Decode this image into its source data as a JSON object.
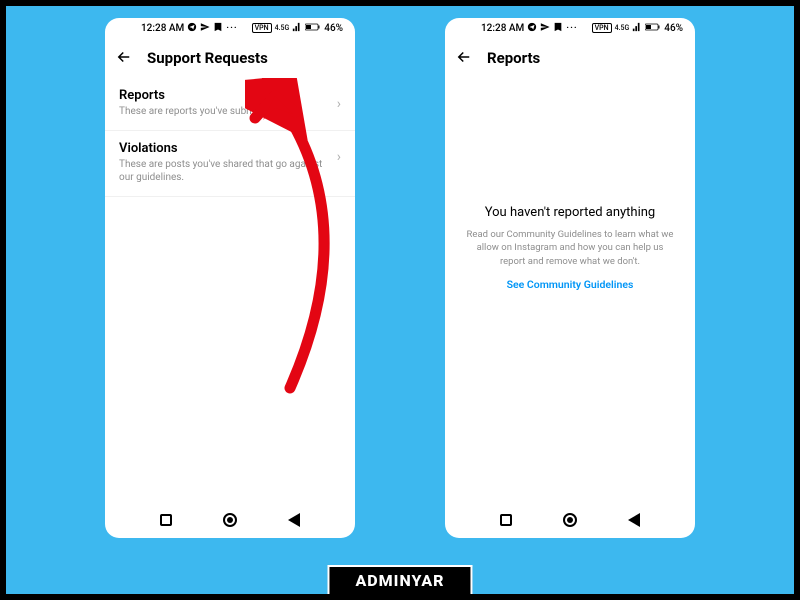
{
  "statusBar": {
    "time": "12:28 AM",
    "vpnLabel": "VPN",
    "networkLabel": "4.5G",
    "batteryText": "46%"
  },
  "phoneLeft": {
    "headerTitle": "Support Requests",
    "items": [
      {
        "title": "Reports",
        "desc": "These are reports you've submitted."
      },
      {
        "title": "Violations",
        "desc": "These are posts you've shared that go against our guidelines."
      }
    ]
  },
  "phoneRight": {
    "headerTitle": "Reports",
    "empty": {
      "title": "You haven't reported anything",
      "desc": "Read our Community Guidelines to learn what we allow on Instagram and how you can help us report and remove what we don't.",
      "link": "See Community Guidelines"
    }
  },
  "footer": "ADMINYAR"
}
